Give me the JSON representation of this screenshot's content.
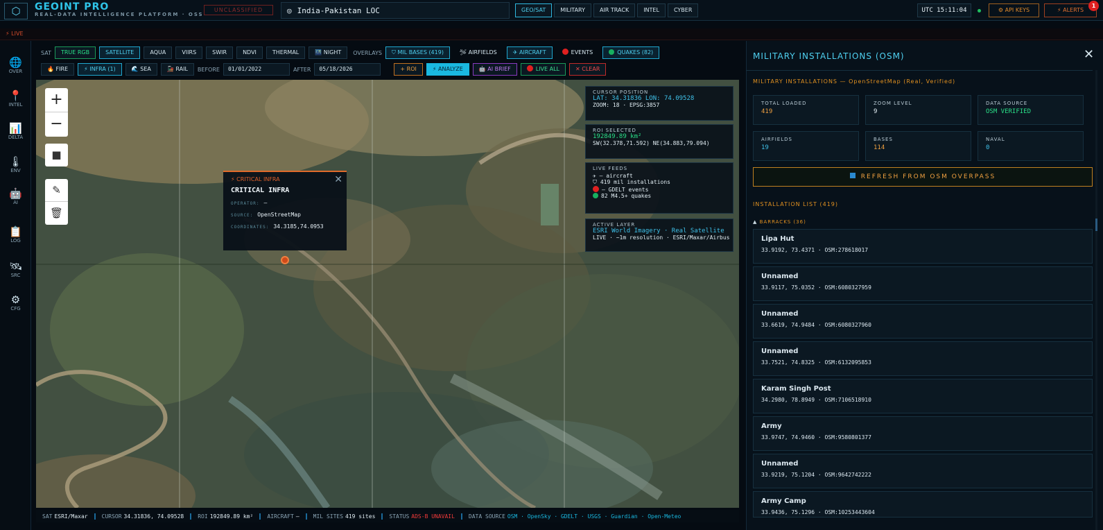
{
  "app": {
    "title": "GEOINT PRO",
    "subtitle": "REAL-DATA INTELLIGENCE PLATFORM · OSS",
    "classification": "UNCLASSIFIED",
    "logo_icon": "hexagon-icon"
  },
  "search": {
    "value": "India-Pakistan LOC",
    "icon": "target-icon"
  },
  "nav": [
    "GEO/SAT",
    "MILITARY",
    "AIR TRACK",
    "INTEL",
    "CYBER"
  ],
  "header": {
    "utc": "UTC 15:11:04",
    "api_keys": "⚙ API KEYS",
    "alerts": "⚡ ALERTS",
    "alert_count": "1",
    "live": "⚡ LIVE"
  },
  "sidebar": [
    {
      "icon": "🌐",
      "label": "OVER"
    },
    {
      "icon": "📍",
      "label": "INTEL"
    },
    {
      "icon": "📊",
      "label": "DELTA"
    },
    {
      "icon": "🌡",
      "label": "ENV"
    },
    {
      "icon": "🤖",
      "label": "AI"
    },
    {
      "icon": "📋",
      "label": "LOG"
    },
    {
      "icon": "🛰",
      "label": "SRC"
    },
    {
      "icon": "⚙",
      "label": "CFG"
    }
  ],
  "toolbar": {
    "sat_label": "SAT",
    "true_rgb": "TRUE RGB",
    "satellite": "SATELLITE",
    "aqua": "AQUA",
    "viirs": "VIIRS",
    "swir": "SWIR",
    "ndvi": "NDVI",
    "thermal": "THERMAL",
    "night": "🌃 NIGHT",
    "overlays_label": "OVERLAYS",
    "mil_bases": "⛉ MIL BASES (419)",
    "airfields": "🛩 AIRFIELDS",
    "aircraft": "✈ AIRCRAFT",
    "events": "EVENTS",
    "quakes": "QUAKES (82)",
    "fire": "🔥 FIRE",
    "infra": "⚡ INFRA (1)",
    "sea": "🌊 SEA",
    "rail": "🚂 RAIL",
    "before_label": "BEFORE",
    "before_date": "01/01/2022",
    "after_label": "AFTER",
    "after_date": "05/18/2026",
    "roi": "+ ROI",
    "analyze": "⚡ ANALYZE",
    "ai_brief": "🤖 AI BRIEF",
    "live_all": "LIVE ALL",
    "clear": "✕ CLEAR"
  },
  "map": {
    "zoom_in": "+",
    "zoom_out": "−",
    "stop": "■",
    "edit": "✎",
    "delete": "🗑",
    "cursor": {
      "title": "CURSOR POSITION",
      "coords": "LAT: 34.31836 LON: 74.09528",
      "zoom": "ZOOM: 18 · EPSG:3857"
    },
    "roi": {
      "title": "ROI SELECTED",
      "area": "192849.89 km²",
      "bounds": "SW(32.378,71.592) NE(34.883,79.094)"
    },
    "feeds": {
      "title": "LIVE FEEDS",
      "aircraft": "✈ – aircraft",
      "mil": "⛉ 419 mil installations",
      "gdelt": "– GDELT events",
      "quakes": "82 M4.5+ quakes"
    },
    "layer": {
      "title": "ACTIVE LAYER",
      "name": "ESRI World Imagery · Real Satellite",
      "res": "LIVE · ~1m resolution · ESRI/Maxar/Airbus"
    },
    "popup": {
      "tag": "⚡ CRITICAL INFRA",
      "title": "CRITICAL INFRA",
      "operator_k": "OPERATOR:",
      "operator_v": "—",
      "source_k": "SOURCE:",
      "source_v": "OpenStreetMap",
      "coords_k": "COORDINATES:",
      "coords_v": "34.3185,74.0953"
    }
  },
  "status": {
    "sat_k": "SAT",
    "sat_v": "ESRI/Maxar",
    "cursor_k": "CURSOR",
    "cursor_v": "34.31836, 74.09528",
    "roi_k": "ROI",
    "roi_v": "192849.89 km²",
    "aircraft_k": "AIRCRAFT",
    "aircraft_v": "–",
    "mil_k": "MIL SITES",
    "mil_v": "419 sites",
    "status_k": "STATUS",
    "status_v": "ADS-B UNAVAIL",
    "ds_k": "DATA SOURCE",
    "ds_v": "OSM · OpenSky · GDELT · USGS · Guardian · Open-Meteo"
  },
  "panel": {
    "title": "MILITARY INSTALLATIONS (OSM)",
    "close": "✕",
    "subtitle": "MILITARY INSTALLATIONS — OpenStreetMap (Real, Verified)",
    "stats": [
      {
        "k": "TOTAL LOADED",
        "v": "419",
        "color": "#f0a040"
      },
      {
        "k": "ZOOM LEVEL",
        "v": "9",
        "color": "#e8f2f8"
      },
      {
        "k": "DATA SOURCE",
        "v": "OSM VERIFIED",
        "color": "#2ae088"
      },
      {
        "k": "AIRFIELDS",
        "v": "19",
        "color": "#3fc0e8"
      },
      {
        "k": "BASES",
        "v": "114",
        "color": "#f0a040"
      },
      {
        "k": "NAVAL",
        "v": "0",
        "color": "#3fc0e8"
      }
    ],
    "refresh": "REFRESH FROM OSM OVERPASS",
    "list_header": "INSTALLATION LIST (419)",
    "category": "BARRACKS (36)",
    "items": [
      {
        "name": "Lipa Hut",
        "coords": "33.9192, 73.4371 · OSM:278618017"
      },
      {
        "name": "Unnamed",
        "coords": "33.9117, 75.0352 · OSM:6080327959"
      },
      {
        "name": "Unnamed",
        "coords": "33.6619, 74.9484 · OSM:6080327960"
      },
      {
        "name": "Unnamed",
        "coords": "33.7521, 74.8325 · OSM:6132095853"
      },
      {
        "name": "Karam Singh Post",
        "coords": "34.2980, 78.8949 · OSM:7106518910"
      },
      {
        "name": "Army",
        "coords": "33.9747, 74.9460 · OSM:9580801377"
      },
      {
        "name": "Unnamed",
        "coords": "33.9219, 75.1204 · OSM:9642742222"
      },
      {
        "name": "Army Camp",
        "coords": "33.9436, 75.1296 · OSM:10253443604"
      }
    ]
  }
}
